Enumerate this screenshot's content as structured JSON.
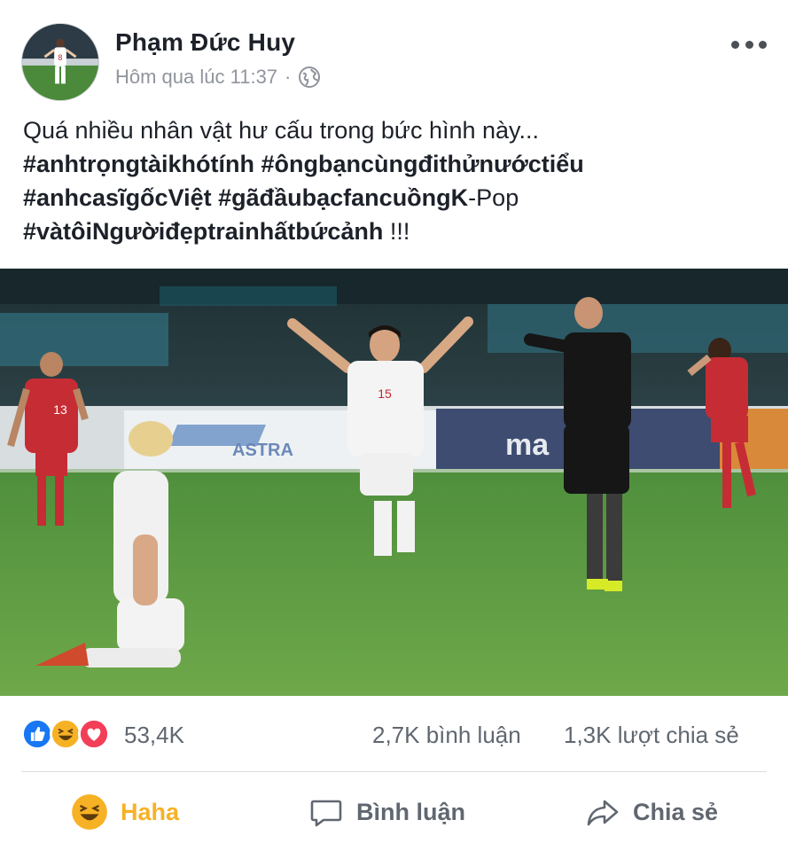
{
  "post": {
    "author_name": "Phạm Đức Huy",
    "timestamp": "Hôm qua lúc 11:37",
    "separator": "·",
    "privacy_icon": "globe-icon",
    "more_icon": "more-options-icon"
  },
  "caption": {
    "line1": "Quá nhiều nhân vật hư cấu trong bức hình này...",
    "tag1": "#anhtrọngtàikhótính",
    "tag2": "#ôngbạncùngđithửnướctiểu",
    "tag3": "#anhcasĩgốcViệt",
    "tag4": "#gãđầubạcfancuồngK",
    "tag4_suffix": "-Pop",
    "tag5": "#vàtôiNgườiđẹptrainhấtbứcảnh",
    "tag5_suffix": " !!!"
  },
  "photo": {
    "banner_left": "ASTRA",
    "banner_right": "ma",
    "player_center_number": "15",
    "player_left_number": "13"
  },
  "stats": {
    "reaction_icons": [
      "like-icon",
      "haha-icon",
      "love-icon"
    ],
    "reactions_count": "53,4K",
    "comments_count": "2,7K bình luận",
    "shares_count": "1,3K lượt chia sẻ"
  },
  "actions": {
    "reaction_label": "Haha",
    "comment_label": "Bình luận",
    "share_label": "Chia sẻ"
  },
  "colors": {
    "haha": "#f7b125",
    "like": "#1877f2",
    "love": "#f33e58",
    "muted": "#606770",
    "text": "#1d2129"
  }
}
